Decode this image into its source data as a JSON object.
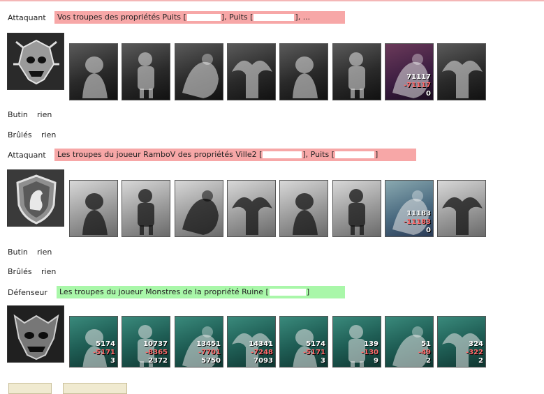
{
  "sections": [
    {
      "role": "Attaquant",
      "description_start": "Vos troupes des propriétés Puits [",
      "description_mid": "], Puits [",
      "description_end": "], ...",
      "hero_icon": "demon-skull-crest-icon",
      "units": [
        {
          "icon": "dragon-creature-icon",
          "style": "grey"
        },
        {
          "icon": "skeleton-warrior-icon",
          "style": "grey"
        },
        {
          "icon": "ghoul-icon",
          "style": "grey"
        },
        {
          "icon": "gargoyle-icon",
          "style": "grey"
        },
        {
          "icon": "golem-icon",
          "style": "grey"
        },
        {
          "icon": "knight-icon",
          "style": "grey"
        },
        {
          "icon": "warlord-icon",
          "style": "color1",
          "alive": "71117",
          "lost": "-71117",
          "remaining": "0"
        },
        {
          "icon": "wraith-icon",
          "style": "grey"
        }
      ],
      "loot_label": "Butin",
      "loot_value": "rien",
      "burnt_label": "Brûlés",
      "burnt_value": "rien"
    },
    {
      "role": "Attaquant",
      "description_start": "Les troupes du joueur RamboV des propriétés Ville2 [",
      "description_mid": "], Puits [",
      "description_end": "]",
      "hero_icon": "lion-shield-crest-icon",
      "units": [
        {
          "icon": "cavalry-icon",
          "style": "light"
        },
        {
          "icon": "footman-icon",
          "style": "light"
        },
        {
          "icon": "horseman-icon",
          "style": "light"
        },
        {
          "icon": "pegasus-icon",
          "style": "light"
        },
        {
          "icon": "crossbowman-icon",
          "style": "light"
        },
        {
          "icon": "monk-icon",
          "style": "light"
        },
        {
          "icon": "paladin-icon",
          "style": "color2",
          "alive": "11183",
          "lost": "-11183",
          "remaining": "0"
        },
        {
          "icon": "angel-icon",
          "style": "light"
        }
      ],
      "loot_label": "Butin",
      "loot_value": "rien",
      "burnt_label": "Brûlés",
      "burnt_value": "rien"
    },
    {
      "role": "Défenseur",
      "description_start": "Les troupes du joueur Monstres de la propriété Ruine [",
      "description_mid": "",
      "description_end": "]",
      "hero_icon": "monster-face-crest-icon",
      "units": [
        {
          "icon": "goblin-icon",
          "style": "teal",
          "alive": "5174",
          "lost": "-5171",
          "remaining": "3"
        },
        {
          "icon": "ogre-icon",
          "style": "teal",
          "alive": "10737",
          "lost": "-8365",
          "remaining": "2372"
        },
        {
          "icon": "orc-warrior-icon",
          "style": "teal",
          "alive": "13451",
          "lost": "-7701",
          "remaining": "5750"
        },
        {
          "icon": "demon-icon",
          "style": "teal",
          "alive": "14341",
          "lost": "-7248",
          "remaining": "7093"
        },
        {
          "icon": "spider-icon",
          "style": "teal",
          "alive": "5174",
          "lost": "-5171",
          "remaining": "3"
        },
        {
          "icon": "imp-icon",
          "style": "teal",
          "alive": "139",
          "lost": "-130",
          "remaining": "9"
        },
        {
          "icon": "stone-titan-icon",
          "style": "teal",
          "alive": "51",
          "lost": "-49",
          "remaining": "2"
        },
        {
          "icon": "sorceress-icon",
          "style": "teal",
          "alive": "324",
          "lost": "-322",
          "remaining": "2"
        }
      ]
    }
  ],
  "colors": {
    "attacker_bar": "#f7a7a7",
    "defender_bar": "#a9f7a9"
  }
}
